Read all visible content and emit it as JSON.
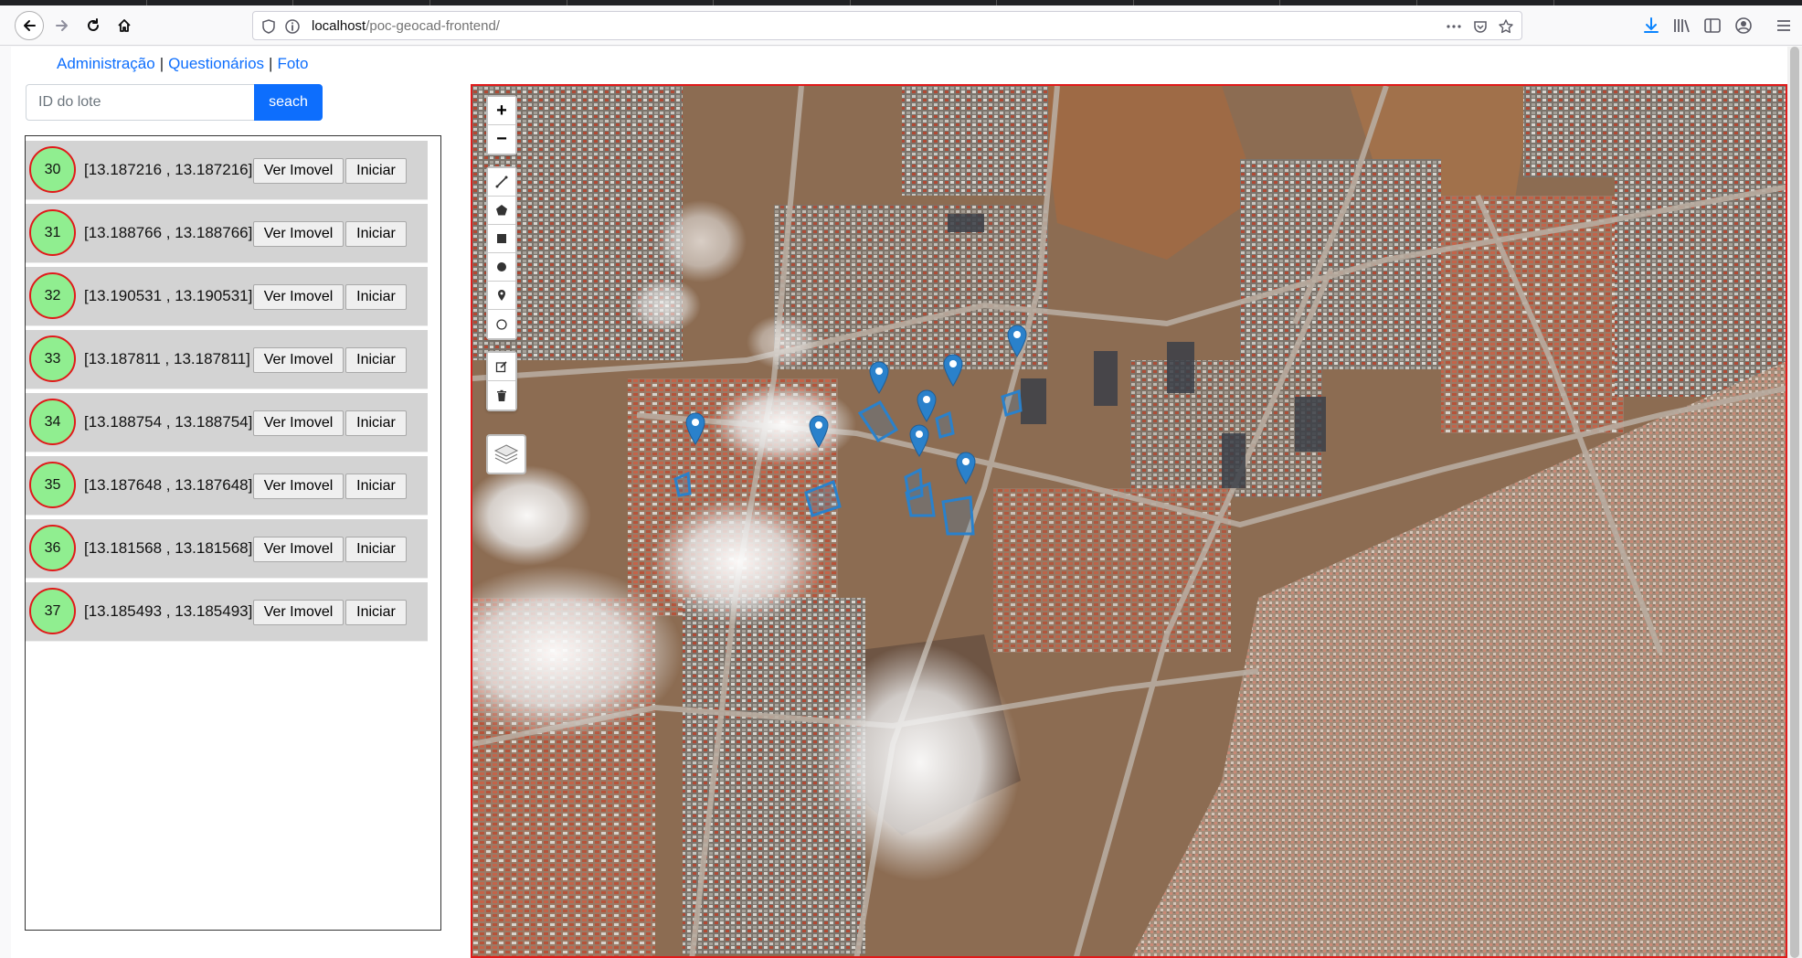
{
  "browser": {
    "url_host": "localhost",
    "url_path": "/poc-geocad-frontend/"
  },
  "nav": {
    "admin": "Administração",
    "separator": "|",
    "questionarios": "Questionários",
    "foto": "Foto"
  },
  "search": {
    "placeholder": "ID do lote",
    "value": "",
    "button_label": "seach"
  },
  "lots": [
    {
      "id": "30",
      "coords": "[13.187216 , 13.187216]",
      "ver": "Ver Imovel",
      "iniciar": "Iniciar"
    },
    {
      "id": "31",
      "coords": "[13.188766 , 13.188766]",
      "ver": "Ver Imovel",
      "iniciar": "Iniciar"
    },
    {
      "id": "32",
      "coords": "[13.190531 , 13.190531]",
      "ver": "Ver Imovel",
      "iniciar": "Iniciar"
    },
    {
      "id": "33",
      "coords": "[13.187811 , 13.187811]",
      "ver": "Ver Imovel",
      "iniciar": "Iniciar"
    },
    {
      "id": "34",
      "coords": "[13.188754 , 13.188754]",
      "ver": "Ver Imovel",
      "iniciar": "Iniciar"
    },
    {
      "id": "35",
      "coords": "[13.187648 , 13.187648]",
      "ver": "Ver Imovel",
      "iniciar": "Iniciar"
    },
    {
      "id": "36",
      "coords": "[13.181568 , 13.181568]",
      "ver": "Ver Imovel",
      "iniciar": "Iniciar"
    },
    {
      "id": "37",
      "coords": "[13.185493 , 13.185493]",
      "ver": "Ver Imovel",
      "iniciar": "Iniciar"
    }
  ],
  "map": {
    "zoom_in": "+",
    "zoom_out": "−",
    "draw_tools": [
      "polyline-icon",
      "polygon-icon",
      "rectangle-icon",
      "circle-icon",
      "marker-icon",
      "circlemarker-icon"
    ],
    "edit_tools": [
      "edit-icon",
      "trash-icon"
    ],
    "layers_icon": "layers-icon",
    "marker_color": "#2a81cb",
    "border_color": "#e01a1a"
  },
  "colors": {
    "link": "#0d6efd",
    "button_primary": "#0d6efd",
    "circle_fill": "#90ee90",
    "circle_border": "#e01a1a",
    "row_bg": "#d3d3d3"
  }
}
